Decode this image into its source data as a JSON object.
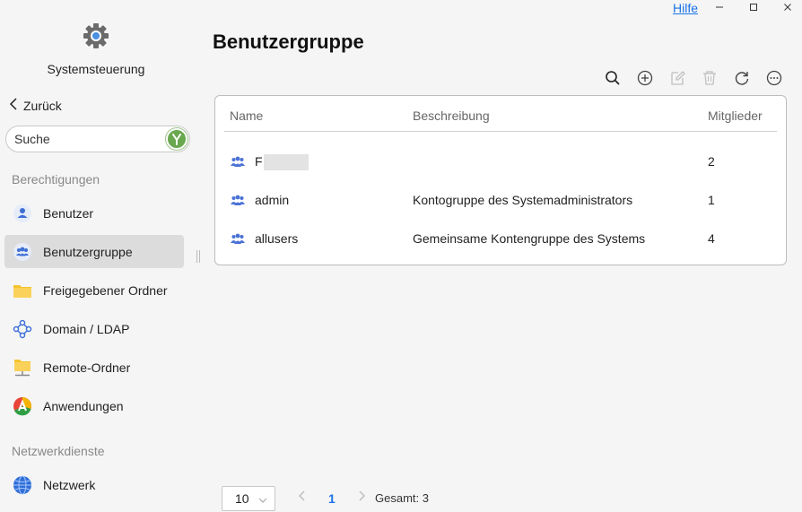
{
  "window": {
    "help_label": "Hilfe",
    "minimize_icon": "minimize-icon",
    "maximize_icon": "maximize-icon",
    "close_icon": "close-icon"
  },
  "app": {
    "title": "Systemsteuerung",
    "icon": "gear-icon",
    "accent": "#4a90e2"
  },
  "sidebar": {
    "back_label": "Zurück",
    "search_placeholder": "Suche",
    "sections": [
      {
        "title": "Berechtigungen",
        "items": [
          {
            "label": "Benutzer",
            "icon": "user-icon",
            "active": false
          },
          {
            "label": "Benutzergruppe",
            "icon": "user-group-icon",
            "active": true
          },
          {
            "label": "Freigegebener Ordner",
            "icon": "folder-icon",
            "active": false
          },
          {
            "label": "Domain / LDAP",
            "icon": "domain-icon",
            "active": false
          },
          {
            "label": "Remote-Ordner",
            "icon": "remote-folder-icon",
            "active": false
          },
          {
            "label": "Anwendungen",
            "icon": "applications-icon",
            "active": false
          }
        ]
      },
      {
        "title": "Netzwerkdienste",
        "items": [
          {
            "label": "Netzwerk",
            "icon": "network-globe-icon",
            "active": false
          }
        ]
      }
    ]
  },
  "main": {
    "title": "Benutzergruppe",
    "toolbar": [
      "search-icon",
      "add-icon",
      "edit-icon",
      "delete-icon",
      "refresh-icon",
      "more-icon"
    ],
    "table": {
      "columns": [
        "Name",
        "Beschreibung",
        "Mitglieder"
      ],
      "rows": [
        {
          "name": "F",
          "description": "",
          "members": "2"
        },
        {
          "name": "admin",
          "description": "Kontogruppe des Systemadministrators",
          "members": "1"
        },
        {
          "name": "allusers",
          "description": "Gemeinsame Kontengruppe des Systems",
          "members": "4"
        }
      ]
    },
    "pagination": {
      "page_size": "10",
      "current_page": "1",
      "total_label": "Gesamt: 3"
    }
  }
}
